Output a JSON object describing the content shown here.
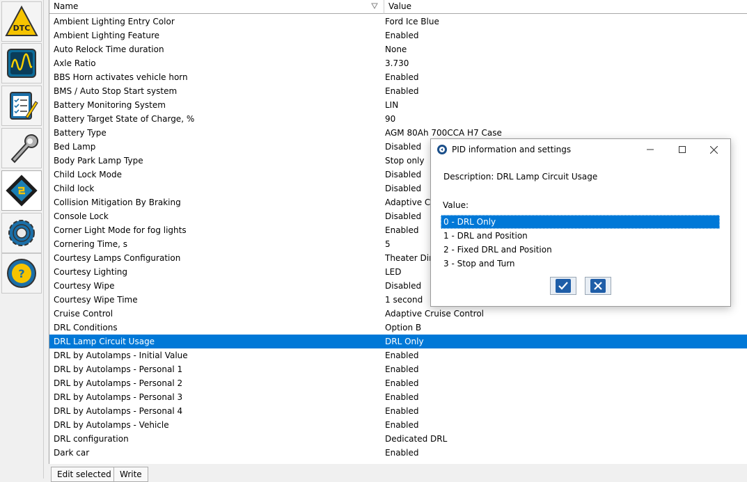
{
  "sidebar": {
    "items": [
      {
        "label": "DTC"
      },
      {
        "label": ""
      },
      {
        "label": ""
      },
      {
        "label": ""
      },
      {
        "label": ""
      },
      {
        "label": ""
      },
      {
        "label": ""
      }
    ]
  },
  "table": {
    "columns": {
      "name": "Name",
      "value": "Value"
    },
    "rows": [
      {
        "name": "Ambient Lighting Entry Color",
        "value": "Ford Ice Blue"
      },
      {
        "name": "Ambient Lighting Feature",
        "value": "Enabled"
      },
      {
        "name": "Auto Relock Time duration",
        "value": "None"
      },
      {
        "name": "Axle Ratio",
        "value": "3.730"
      },
      {
        "name": "BBS Horn activates vehicle horn",
        "value": "Enabled"
      },
      {
        "name": "BMS / Auto Stop Start system",
        "value": "Enabled"
      },
      {
        "name": "Battery Monitoring System",
        "value": "LIN"
      },
      {
        "name": "Battery Target State of Charge, %",
        "value": "90"
      },
      {
        "name": "Battery Type",
        "value": "AGM 80Ah 700CCA H7 Case"
      },
      {
        "name": "Bed Lamp",
        "value": "Disabled"
      },
      {
        "name": "Body Park Lamp Type",
        "value": "Stop only"
      },
      {
        "name": "Child Lock Mode",
        "value": "Disabled"
      },
      {
        "name": "Child lock",
        "value": "Disabled"
      },
      {
        "name": "Collision Mitigation By Braking",
        "value": "Adaptive Cr"
      },
      {
        "name": "Console Lock",
        "value": "Disabled"
      },
      {
        "name": "Corner Light Mode for fog lights",
        "value": "Enabled"
      },
      {
        "name": "Cornering Time, s",
        "value": "5"
      },
      {
        "name": "Courtesy Lamps Configuration",
        "value": "Theater Dim"
      },
      {
        "name": "Courtesy Lighting",
        "value": "LED"
      },
      {
        "name": "Courtesy Wipe",
        "value": "Disabled"
      },
      {
        "name": "Courtesy Wipe Time",
        "value": "1 second"
      },
      {
        "name": "Cruise Control",
        "value": "Adaptive Cruise Control"
      },
      {
        "name": "DRL Conditions",
        "value": "Option B"
      },
      {
        "name": "DRL Lamp Circuit Usage",
        "value": "DRL Only",
        "selected": true
      },
      {
        "name": "DRL by Autolamps - Initial Value",
        "value": "Enabled"
      },
      {
        "name": "DRL by Autolamps - Personal 1",
        "value": "Enabled"
      },
      {
        "name": "DRL by Autolamps - Personal 2",
        "value": "Enabled"
      },
      {
        "name": "DRL by Autolamps - Personal 3",
        "value": "Enabled"
      },
      {
        "name": "DRL by Autolamps - Personal 4",
        "value": "Enabled"
      },
      {
        "name": "DRL by Autolamps - Vehicle",
        "value": "Enabled"
      },
      {
        "name": "DRL configuration",
        "value": "Dedicated DRL"
      },
      {
        "name": "Dark car",
        "value": "Enabled"
      }
    ]
  },
  "bottom": {
    "edit_label": "Edit selected",
    "write_label": "Write"
  },
  "dialog": {
    "title": "PID information and settings",
    "description": "Description: DRL Lamp Circuit Usage",
    "value_label": "Value:",
    "options": [
      {
        "label": "0 - DRL Only",
        "selected": true
      },
      {
        "label": "1 - DRL and Position"
      },
      {
        "label": "2 - Fixed DRL and Position"
      },
      {
        "label": "3 - Stop and Turn"
      }
    ]
  },
  "colors": {
    "selection": "#0078d7",
    "button_blue": "#1f5ea8"
  }
}
